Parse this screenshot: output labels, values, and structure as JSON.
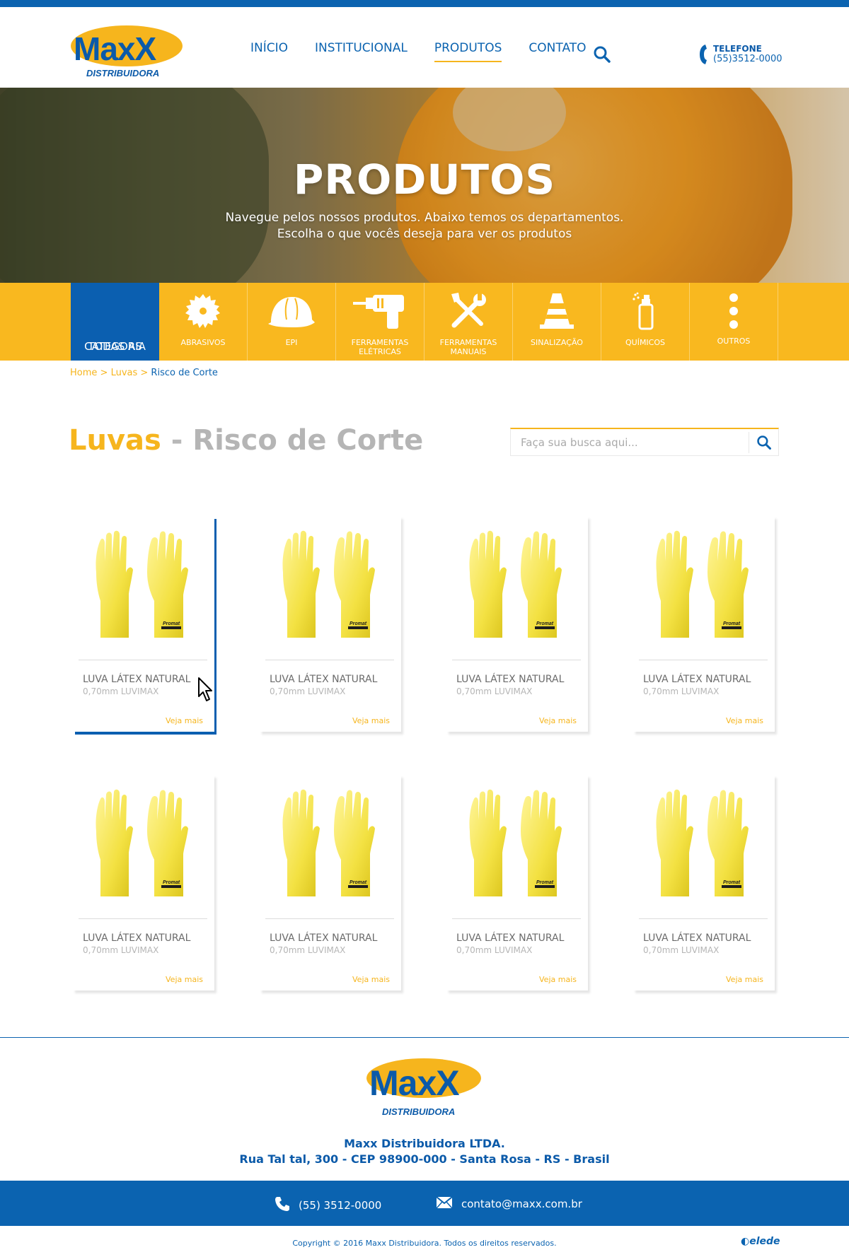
{
  "brand": {
    "word": "MaxX",
    "sub": "DISTRIBUIDORA",
    "colors": {
      "blue": "#0b63b0",
      "yellow": "#f6b51d"
    }
  },
  "nav": {
    "items": [
      "INÍCIO",
      "INSTITUCIONAL",
      "PRODUTOS",
      "CONTATO"
    ],
    "active": "PRODUTOS"
  },
  "phone": {
    "label": "TELEFONE",
    "number": "(55)3512-0000"
  },
  "hero": {
    "title": "PRODUTOS",
    "line1": "Navegue pelos nossos produtos. Abaixo temos os departamentos.",
    "line2": "Escolha o que vocês deseja para ver os produtos"
  },
  "categories": {
    "all_line1": "TODAS AS",
    "all_line2": "CATEGORIA",
    "items": [
      {
        "label1": "ABRASIVOS",
        "label2": "",
        "icon": "saw-blade-icon"
      },
      {
        "label1": "EPI",
        "label2": "",
        "icon": "helmet-icon"
      },
      {
        "label1": "FERRAMENTAS",
        "label2": "ELÉTRICAS",
        "icon": "drill-icon"
      },
      {
        "label1": "FERRAMENTAS",
        "label2": "MANUAIS",
        "icon": "tools-icon"
      },
      {
        "label1": "SINALIZAÇÃO",
        "label2": "",
        "icon": "cone-icon"
      },
      {
        "label1": "QUÍMICOS",
        "label2": "",
        "icon": "spray-icon"
      },
      {
        "label1": "OUTROS",
        "label2": "",
        "icon": "more-icon"
      }
    ]
  },
  "breadcrumb": {
    "home": "Home",
    "sep": " > ",
    "level1": "Luvas",
    "current": "Risco de Corte"
  },
  "page_title": {
    "part1": "Luvas",
    "sep": " - ",
    "part2": "Risco de Corte"
  },
  "search": {
    "placeholder": "Faça sua busca aqui..."
  },
  "products": [
    {
      "name": "LUVA LÁTEX NATURAL",
      "sub": "0,70mm LUVIMAX",
      "more": "Veja mais",
      "brand_mark": "Promat"
    },
    {
      "name": "LUVA LÁTEX NATURAL",
      "sub": "0,70mm LUVIMAX",
      "more": "Veja mais",
      "brand_mark": "Promat"
    },
    {
      "name": "LUVA LÁTEX NATURAL",
      "sub": "0,70mm LUVIMAX",
      "more": "Veja mais",
      "brand_mark": "Promat"
    },
    {
      "name": "LUVA LÁTEX NATURAL",
      "sub": "0,70mm LUVIMAX",
      "more": "Veja mais",
      "brand_mark": "Promat"
    },
    {
      "name": "LUVA LÁTEX NATURAL",
      "sub": "0,70mm LUVIMAX",
      "more": "Veja mais",
      "brand_mark": "Promat"
    },
    {
      "name": "LUVA LÁTEX NATURAL",
      "sub": "0,70mm LUVIMAX",
      "more": "Veja mais",
      "brand_mark": "Promat"
    },
    {
      "name": "LUVA LÁTEX NATURAL",
      "sub": "0,70mm LUVIMAX",
      "more": "Veja mais",
      "brand_mark": "Promat"
    },
    {
      "name": "LUVA LÁTEX NATURAL",
      "sub": "0,70mm LUVIMAX",
      "more": "Veja mais",
      "brand_mark": "Promat"
    }
  ],
  "footer": {
    "company": "Maxx Distribuidora LTDA.",
    "address": "Rua Tal tal, 300 - CEP 98900-000 - Santa Rosa - RS - Brasil",
    "phone": "(55) 3512-0000",
    "email": "contato@maxx.com.br",
    "copyright": "Copyright © 2016 Maxx Distribuidora. Todos os direitos reservados.",
    "credit": "elede"
  }
}
